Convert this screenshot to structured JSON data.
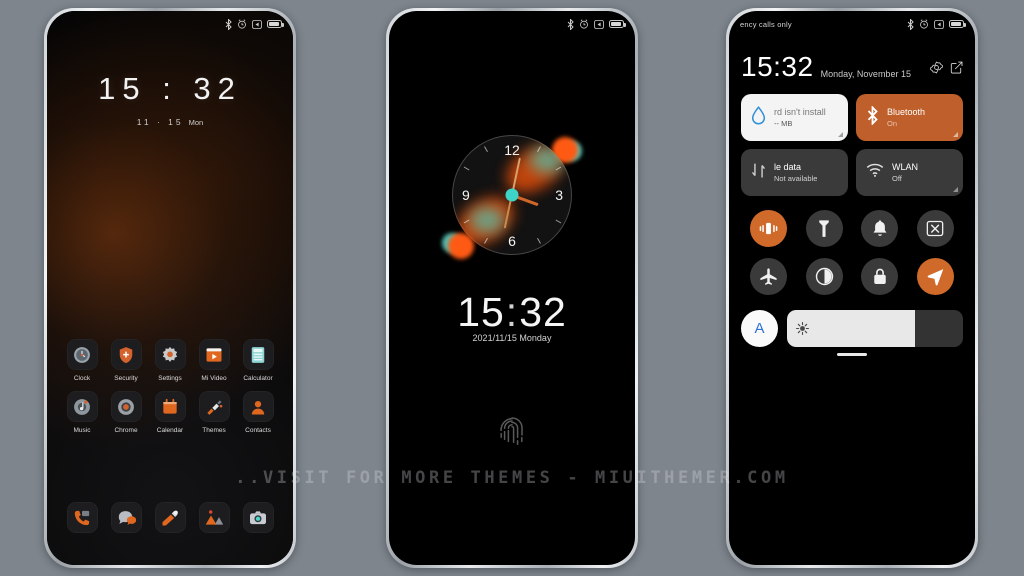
{
  "background_color": "#7e858d",
  "accent_orange": "#bf5f2b",
  "accent_teal": "#3fd4c8",
  "watermark": "..VISIT FOR MORE THEMES - MIUITHEMER.COM",
  "status_bar": {
    "icons": [
      "bluetooth-icon",
      "alarm-icon",
      "dnd-icon",
      "battery-icon"
    ],
    "carrier_text": "ency calls only"
  },
  "phone1": {
    "aod": {
      "time": "15 : 32",
      "date": "11 · 15",
      "day_of_week": "Mon"
    },
    "apps_row1": [
      {
        "label": "Clock",
        "icon": "clock-icon"
      },
      {
        "label": "Security",
        "icon": "shield-icon"
      },
      {
        "label": "Settings",
        "icon": "gear-icon"
      },
      {
        "label": "Mi Video",
        "icon": "video-play-icon"
      },
      {
        "label": "Calculator",
        "icon": "calculator-icon"
      }
    ],
    "apps_row2": [
      {
        "label": "Music",
        "icon": "music-note-icon"
      },
      {
        "label": "Chrome",
        "icon": "chrome-icon"
      },
      {
        "label": "Calendar",
        "icon": "calendar-icon"
      },
      {
        "label": "Themes",
        "icon": "themes-brush-icon"
      },
      {
        "label": "Contacts",
        "icon": "contacts-person-icon"
      }
    ],
    "dock": [
      {
        "label": "Phone",
        "icon": "phone-handset-icon"
      },
      {
        "label": "Messages",
        "icon": "messages-bubble-icon"
      },
      {
        "label": "File Manager",
        "icon": "file-manager-icon"
      },
      {
        "label": "Gallery",
        "icon": "gallery-mountain-icon"
      },
      {
        "label": "Camera",
        "icon": "camera-icon"
      }
    ]
  },
  "phone2": {
    "analog_clock": {
      "numbers": [
        "12",
        "3",
        "6",
        "9"
      ],
      "hour_angle_deg": 110,
      "minute_angle_deg": 12,
      "second_angle_deg": 192
    },
    "lock_time_hours": "15",
    "lock_time_colon": ":",
    "lock_time_minutes": "32",
    "lock_date": "2021/11/15 Monday",
    "fingerprint_icon": "fingerprint-icon"
  },
  "phone3": {
    "header": {
      "carrier": "ency calls only",
      "time": "15:32",
      "date": "Monday, November 15",
      "settings_icon": "gear-icon",
      "edit_icon": "edit-icon"
    },
    "tiles": [
      {
        "title": "rd isn't install",
        "subtitle": "-- MB",
        "state": "light",
        "icon": "water-drop-icon"
      },
      {
        "title": "Bluetooth",
        "subtitle": "On",
        "state": "accent",
        "icon": "bluetooth-icon"
      },
      {
        "title": "le data",
        "subtitle": "Not available",
        "state": "dark",
        "icon": "data-arrows-icon"
      },
      {
        "title": "WLAN",
        "subtitle": "Off",
        "state": "dark",
        "icon": "wifi-icon"
      }
    ],
    "toggles": [
      {
        "name": "vibrate",
        "icon": "vibrate-icon",
        "active": true
      },
      {
        "name": "flashlight",
        "icon": "flashlight-icon",
        "active": false
      },
      {
        "name": "notifications",
        "icon": "bell-icon",
        "active": false
      },
      {
        "name": "screen-cast",
        "icon": "cast-icon",
        "active": false
      },
      {
        "name": "airplane-mode",
        "icon": "airplane-icon",
        "active": false
      },
      {
        "name": "dark-mode",
        "icon": "contrast-icon",
        "active": false
      },
      {
        "name": "screen-lock",
        "icon": "lock-icon",
        "active": false
      },
      {
        "name": "location",
        "icon": "location-arrow-icon",
        "active": true
      }
    ],
    "brightness": {
      "auto_label": "A",
      "level_percent": 73,
      "icon": "sun-icon"
    }
  }
}
